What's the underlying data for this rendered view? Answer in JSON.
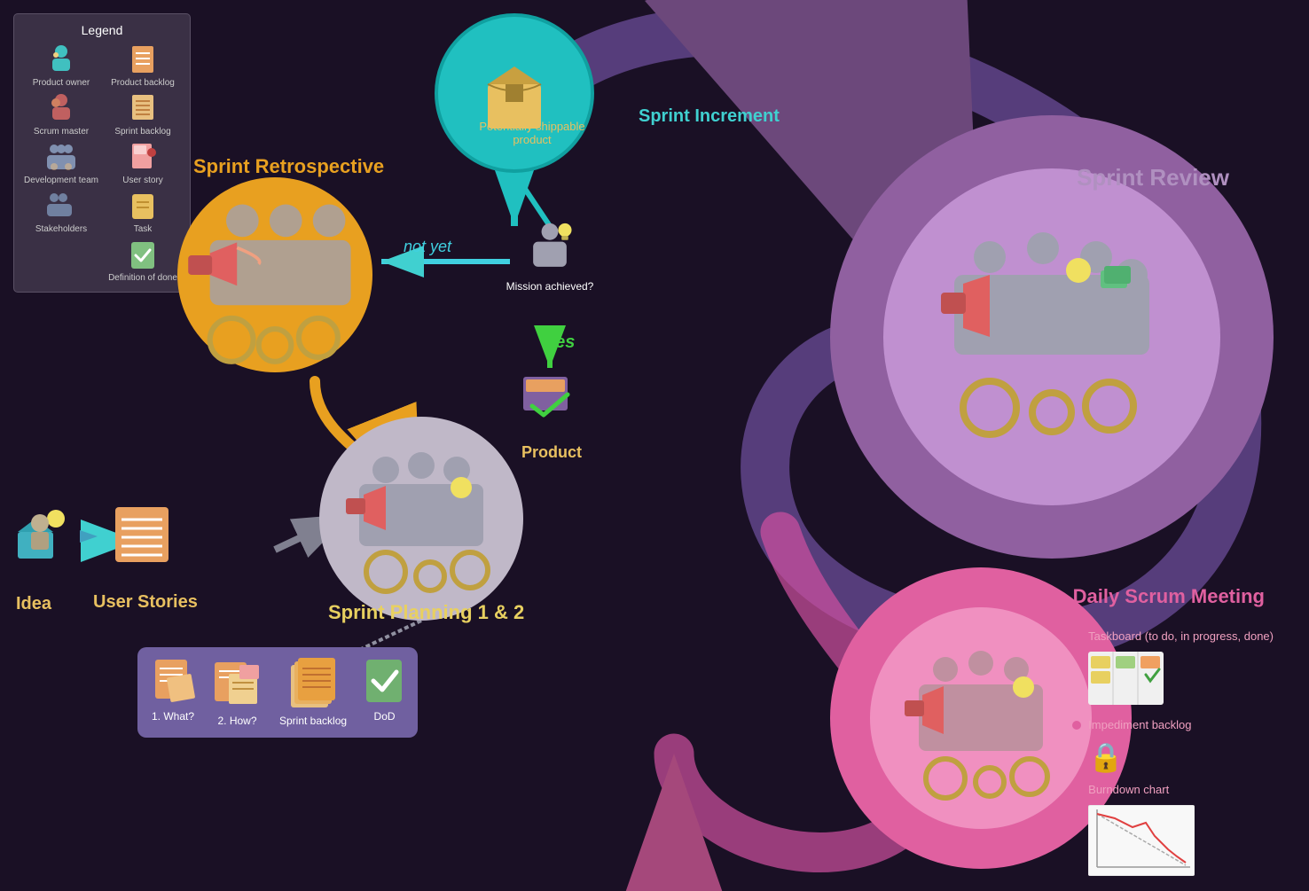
{
  "legend": {
    "title": "Legend",
    "items": [
      {
        "label": "Product owner",
        "type": "person-teal"
      },
      {
        "label": "Product backlog",
        "type": "doc-orange"
      },
      {
        "label": "Scrum master",
        "type": "person-red"
      },
      {
        "label": "Sprint backlog",
        "type": "doc-striped"
      },
      {
        "label": "Development team",
        "type": "person-group"
      },
      {
        "label": "User story",
        "type": "doc-pink"
      },
      {
        "label": "Stakeholders",
        "type": "person-group2"
      },
      {
        "label": "Task",
        "type": "doc-task"
      },
      {
        "label": "",
        "type": "empty"
      },
      {
        "label": "Definition of done",
        "type": "check-green"
      }
    ]
  },
  "labels": {
    "sprint_retro": "Sprint Retrospective",
    "sprint_review": "Sprint Review",
    "sprint_increment": "Sprint Increment",
    "sprint_planning": "Sprint Planning 1 & 2",
    "daily_scrum": "Daily Scrum Meeting",
    "idea": "Idea",
    "user_stories": "User Stories",
    "mission": "Mission achieved?",
    "not_yet": "not yet",
    "yes": "yes",
    "product": "Product",
    "potentially": "Potentially shippable product"
  },
  "sprint_planning_items": [
    {
      "label": "1. What?",
      "type": "doc"
    },
    {
      "label": "2. How?",
      "type": "doc-sticky"
    },
    {
      "label": "Sprint\nbacklog",
      "type": "doc-stack"
    },
    {
      "label": "DoD",
      "type": "check"
    }
  ],
  "daily_legend": [
    {
      "label": "Taskboard (to do, in progress, done)",
      "dot": true
    },
    {
      "label": "Impediment backlog",
      "dot": true
    },
    {
      "label": "Burndown chart",
      "dot": true
    }
  ]
}
